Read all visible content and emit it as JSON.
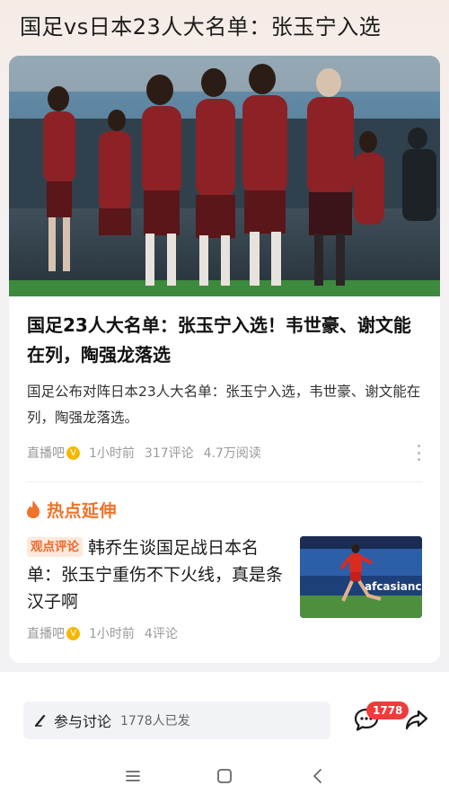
{
  "page": {
    "title": "国足vs日本23人大名单：张玉宁入选"
  },
  "article": {
    "image_alt": "国足球员训练",
    "headline": "国足23人大名单：张玉宁入选！韦世豪、谢文能在列，陶强龙落选",
    "summary": "国足公布对阵日本23人大名单：张玉宁入选，韦世豪、谢文能在列，陶强龙落选。",
    "source": "直播吧",
    "verified_badge": "V",
    "time": "1小时前",
    "comments": "317评论",
    "reads": "4.7万阅读"
  },
  "hot": {
    "section_label": "热点延伸",
    "tag": "观点评论",
    "title": "韩乔生谈国足战日本名单：张玉宁重伤不下火线，真是条汉子啊",
    "source": "直播吧",
    "verified_badge": "V",
    "time": "1小时前",
    "comments": "4评论",
    "thumb_ad_text": "afcasianc"
  },
  "bottom": {
    "discuss_label": "参与讨论",
    "discuss_count": "1778人已发",
    "comment_badge": "1778"
  },
  "colors": {
    "accent": "#f0722a",
    "badge_red": "#ee3b3b",
    "verified": "#f5b800"
  },
  "icons": {
    "pen": "pen-icon",
    "comment": "comment-icon",
    "share": "share-icon",
    "fire": "fire-icon",
    "nav_menu": "menu-icon",
    "nav_home": "home-square-icon",
    "nav_back": "back-chevron-icon"
  }
}
